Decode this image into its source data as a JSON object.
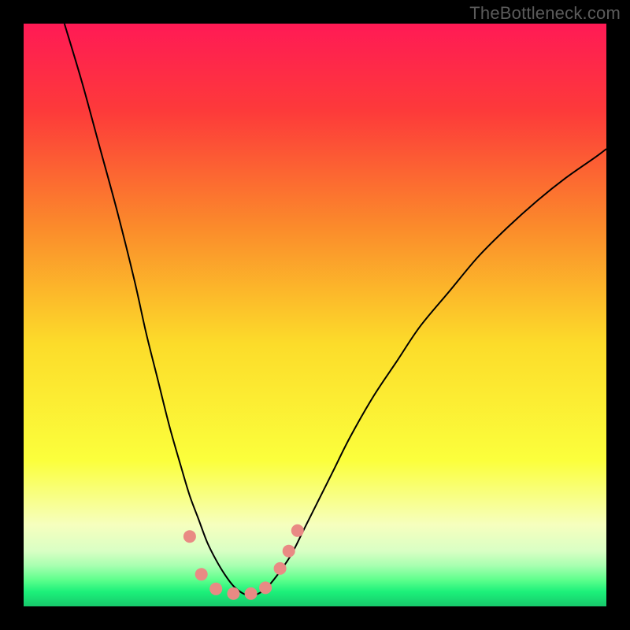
{
  "watermark": "TheBottleneck.com",
  "chart_data": {
    "type": "line",
    "title": "",
    "xlabel": "",
    "ylabel": "",
    "xlim": [
      0,
      100
    ],
    "ylim": [
      0,
      100
    ],
    "background_gradient": {
      "stops": [
        {
          "pos": 0.0,
          "color": "#ff1a55"
        },
        {
          "pos": 0.15,
          "color": "#fd3a3a"
        },
        {
          "pos": 0.35,
          "color": "#fb8b2b"
        },
        {
          "pos": 0.55,
          "color": "#fcdc2a"
        },
        {
          "pos": 0.75,
          "color": "#fbff3c"
        },
        {
          "pos": 0.86,
          "color": "#f6ffbe"
        },
        {
          "pos": 0.905,
          "color": "#d9ffc4"
        },
        {
          "pos": 0.93,
          "color": "#a8ffb0"
        },
        {
          "pos": 0.955,
          "color": "#5cff8c"
        },
        {
          "pos": 0.975,
          "color": "#1cf07a"
        },
        {
          "pos": 1.0,
          "color": "#17c96b"
        }
      ]
    },
    "series": [
      {
        "name": "bottleneck-curve",
        "color": "#000000",
        "width": 2,
        "x": [
          7,
          10,
          13,
          16,
          19,
          21,
          23,
          25,
          27,
          28.5,
          30,
          31.5,
          33,
          34.5,
          36,
          37.5,
          39,
          40.5,
          42,
          44,
          46,
          48,
          50,
          53,
          56,
          60,
          64,
          68,
          73,
          78,
          83,
          88,
          93,
          98,
          100
        ],
        "y": [
          100,
          90,
          79,
          68,
          56,
          47,
          39,
          31,
          24,
          19,
          15,
          11,
          8,
          5.5,
          3.5,
          2.3,
          1.8,
          2.3,
          3.5,
          6,
          9,
          13,
          17,
          23,
          29,
          36,
          42,
          48,
          54,
          60,
          65,
          69.5,
          73.5,
          77,
          78.5
        ]
      }
    ],
    "markers": {
      "color": "#e98a84",
      "radius_px": 8,
      "points": [
        {
          "x": 28.5,
          "y": 12
        },
        {
          "x": 30.5,
          "y": 5.5
        },
        {
          "x": 33.0,
          "y": 3.0
        },
        {
          "x": 36.0,
          "y": 2.2
        },
        {
          "x": 39.0,
          "y": 2.2
        },
        {
          "x": 41.5,
          "y": 3.2
        },
        {
          "x": 44.0,
          "y": 6.5
        },
        {
          "x": 45.5,
          "y": 9.5
        },
        {
          "x": 47.0,
          "y": 13.0
        }
      ]
    }
  }
}
